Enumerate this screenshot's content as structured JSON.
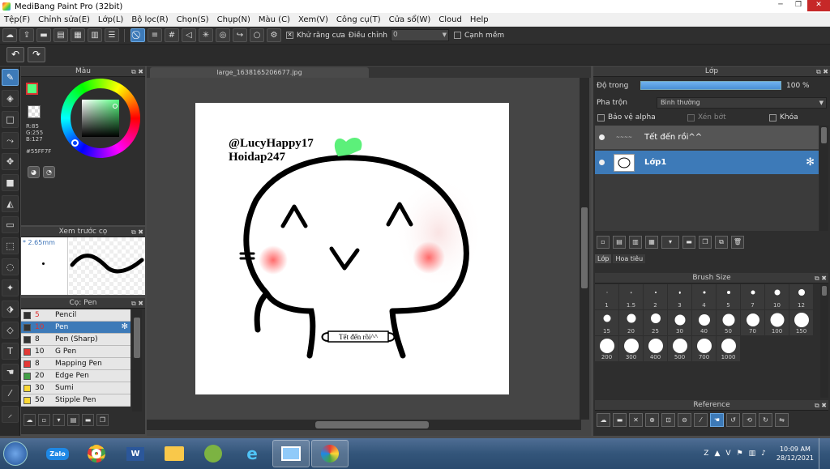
{
  "window": {
    "title": "MediBang Paint Pro (32bit)"
  },
  "menu": [
    "Tệp(F)",
    "Chỉnh sửa(E)",
    "Lớp(L)",
    "Bộ lọc(R)",
    "Chọn(S)",
    "Chụp(N)",
    "Màu (C)",
    "Xem(V)",
    "Công cụ(T)",
    "Cửa sổ(W)",
    "Cloud",
    "Help"
  ],
  "toolbar": {
    "antialias_label": "Khử răng cưa",
    "adjust_label": "Điều chỉnh",
    "adjust_value": "0",
    "smooth_label": "Cạnh mềm"
  },
  "color_panel": {
    "title": "Màu",
    "r": "R:85",
    "g": "G:255",
    "b": "B:127",
    "hex": "#55FF7F",
    "fg_color": "#55ff7f"
  },
  "preview_panel": {
    "title": "Xem trước cọ",
    "size": "* 2.65mm"
  },
  "brush_panel": {
    "title": "Cọ: Pen",
    "brushes": [
      {
        "size": "5",
        "name": "Pencil",
        "color": "#333333"
      },
      {
        "size": "10",
        "name": "Pen",
        "color": "#333333",
        "selected": true
      },
      {
        "size": "8",
        "name": "Pen (Sharp)",
        "color": "#333333"
      },
      {
        "size": "10",
        "name": "G Pen",
        "color": "#e53935"
      },
      {
        "size": "8",
        "name": "Mapping Pen",
        "color": "#e53935"
      },
      {
        "size": "20",
        "name": "Edge Pen",
        "color": "#43a047"
      },
      {
        "size": "30",
        "name": "Sumi",
        "color": "#fdd835"
      },
      {
        "size": "50",
        "name": "Stipple Pen",
        "color": "#fdd835"
      }
    ]
  },
  "canvas": {
    "tab": "large_1638165206677.jpg",
    "text1": "@LucyHappy17",
    "text2": "Hoidap247",
    "banner": "Tết đến rồi^^"
  },
  "layer_panel": {
    "title": "Lớp",
    "opacity_label": "Độ trong",
    "opacity_value": "100 %",
    "opacity_fraction": 1.0,
    "blend_label": "Pha trộn",
    "blend_value": "Bình thường",
    "protect_alpha": "Bảo vệ alpha",
    "clip": "Xén bớt",
    "lock": "Khóa",
    "layers": [
      {
        "name": "Tết đến rồi^^"
      },
      {
        "name": "Lớp1",
        "selected": true
      }
    ]
  },
  "tabs": {
    "layer": "Lớp",
    "pattern": "Hoa tiêu"
  },
  "brush_size_panel": {
    "title": "Brush Size",
    "sizes": [
      "1",
      "1.5",
      "2",
      "3",
      "4",
      "5",
      "7",
      "10",
      "12",
      "15",
      "20",
      "25",
      "30",
      "40",
      "50",
      "70",
      "100",
      "150",
      "200",
      "300",
      "400",
      "500",
      "700",
      "1000"
    ]
  },
  "reference_panel": {
    "title": "Reference"
  },
  "taskbar": {
    "apps": [
      "Zalo",
      "Chrome",
      "Word",
      "Explorer",
      "Coc Coc",
      "Edge",
      "Photos",
      "MediBang"
    ],
    "lang": "V",
    "time": "10:09 AM",
    "date": "28/12/2021"
  }
}
